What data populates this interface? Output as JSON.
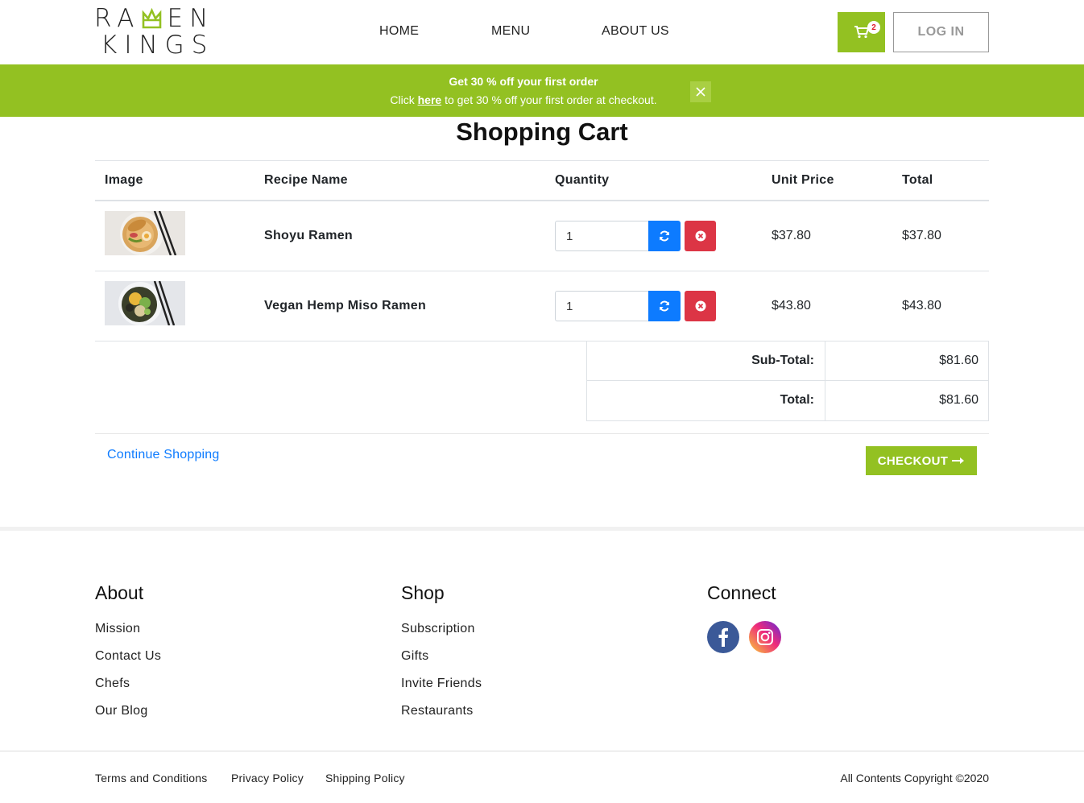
{
  "brand": {
    "line1": "RA EN",
    "line2": "KINGS",
    "line1_left": "RA",
    "line1_right": "EN"
  },
  "nav": {
    "home": "HOME",
    "menu": "MENU",
    "about": "ABOUT US"
  },
  "cart": {
    "badge_count": "2",
    "login_label": "LOG IN"
  },
  "promo": {
    "title": "Get 30 % off your first order",
    "text_before": "Click ",
    "link": "here",
    "text_after": " to get 30 % off your first order at checkout."
  },
  "page_title": "Shopping Cart",
  "table": {
    "headers": {
      "image": "Image",
      "name": "Recipe Name",
      "quantity": "Quantity",
      "unit_price": "Unit Price",
      "total": "Total"
    },
    "rows": [
      {
        "name": "Shoyu Ramen",
        "quantity": "1",
        "unit_price": "$37.80",
        "total": "$37.80"
      },
      {
        "name": "Vegan Hemp Miso Ramen",
        "quantity": "1",
        "unit_price": "$43.80",
        "total": "$43.80"
      }
    ]
  },
  "totals": {
    "subtotal_label": "Sub-Total:",
    "subtotal_value": "$81.60",
    "total_label": "Total:",
    "total_value": "$81.60"
  },
  "actions": {
    "continue": "Continue Shopping",
    "checkout": "CHECKOUT"
  },
  "footer": {
    "about": {
      "heading": "About",
      "links": [
        "Mission",
        "Contact Us",
        "Chefs",
        "Our Blog"
      ]
    },
    "shop": {
      "heading": "Shop",
      "links": [
        "Subscription",
        "Gifts",
        "Invite Friends",
        "Restaurants"
      ]
    },
    "connect": {
      "heading": "Connect"
    },
    "bottom": {
      "terms": "Terms and Conditions",
      "privacy": "Privacy Policy",
      "shipping": "Shipping Policy",
      "copyright": "All Contents Copyright ©2020"
    }
  },
  "colors": {
    "brand_green": "#93c122",
    "refresh_blue": "#0d7bff",
    "remove_red": "#dc3545",
    "link_blue": "#0d7bff"
  },
  "icons": {
    "cart": "shopping-cart-icon",
    "close": "close-icon",
    "refresh": "refresh-icon",
    "remove": "remove-icon",
    "arrow": "arrow-right-icon",
    "facebook": "facebook-icon",
    "instagram": "instagram-icon"
  }
}
